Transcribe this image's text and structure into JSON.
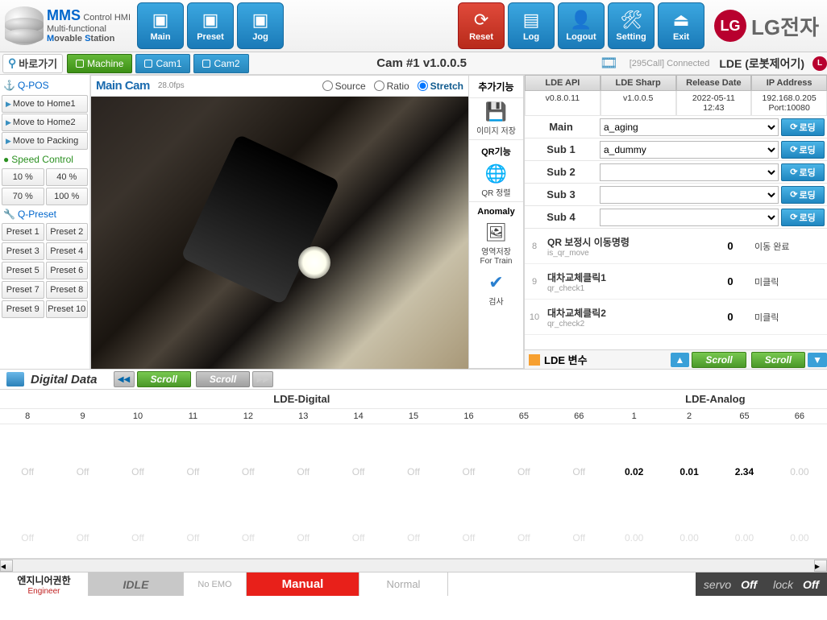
{
  "app": {
    "mms": "MMS",
    "ctrl": "Control HMI",
    "line1": "Multi-functional",
    "line2a": "M",
    "line2b": "ovable ",
    "line2c": "S",
    "line2d": "tation"
  },
  "hdr": {
    "main": "Main",
    "preset": "Preset",
    "jog": "Jog",
    "reset": "Reset",
    "log": "Log",
    "logout": "Logout",
    "setting": "Setting",
    "exit": "Exit"
  },
  "lg": {
    "circle": "LG",
    "text": "LG전자"
  },
  "sub": {
    "shortcuts": "바로가기",
    "machine": "Machine",
    "cam1": "Cam1",
    "cam2": "Cam2",
    "camtitle": "Cam #1 v1.0.0.5",
    "connected": "[295Call] Connected",
    "lde": "LDE (로봇제어기)"
  },
  "side": {
    "qpos": "Q-POS",
    "moves": [
      "Move to Home1",
      "Move to Home2",
      "Move to Packing"
    ],
    "speed": "Speed Control",
    "speeds": [
      "10 %",
      "40 %",
      "70 %",
      "100 %"
    ],
    "qpreset": "Q-Preset",
    "presets": [
      "Preset 1",
      "Preset 2",
      "Preset 3",
      "Preset 4",
      "Preset 5",
      "Preset 6",
      "Preset 7",
      "Preset 8",
      "Preset 9",
      "Preset 10"
    ]
  },
  "cam": {
    "name": "Main Cam",
    "fps": "28.0fps",
    "r1": "Source",
    "r2": "Ratio",
    "r3": "Stretch"
  },
  "extras": {
    "hdr": "추가기능",
    "save": "이미지 저장",
    "qrhdr": "QR기능",
    "qralign": "QR 정렬",
    "anomaly": "Anomaly",
    "train": "영역저장\nFor Train",
    "inspect": "검사"
  },
  "right": {
    "h": [
      "LDE API",
      "LDE Sharp",
      "Release Date",
      "IP Address"
    ],
    "v": [
      "v0.8.0.11",
      "v1.0.0.5",
      "2022-05-11\n12:43",
      "192.168.0.205\nPort:10080"
    ],
    "slots": [
      {
        "lbl": "Main",
        "val": "a_aging"
      },
      {
        "lbl": "Sub 1",
        "val": "a_dummy"
      },
      {
        "lbl": "Sub 2",
        "val": ""
      },
      {
        "lbl": "Sub 3",
        "val": ""
      },
      {
        "lbl": "Sub 4",
        "val": ""
      }
    ],
    "loading": "로딩",
    "vars": [
      {
        "i": "8",
        "n1": "QR 보정시 이동명령",
        "n2": "is_qr_move",
        "v": "0",
        "d": "이동 완료"
      },
      {
        "i": "9",
        "n1": "대차교체클릭1",
        "n2": "qr_check1",
        "v": "0",
        "d": "미클릭"
      },
      {
        "i": "10",
        "n1": "대차교체클릭2",
        "n2": "qr_check2",
        "v": "0",
        "d": "미클릭"
      }
    ],
    "ldevar": "LDE 변수",
    "scroll": "Scroll"
  },
  "dd": {
    "title": "Digital Data",
    "lbl1": "LDE-Digital",
    "lbl2": "LDE-Analog",
    "cols": [
      "8",
      "9",
      "10",
      "11",
      "12",
      "13",
      "14",
      "15",
      "16",
      "65",
      "66",
      "1",
      "2",
      "65",
      "66"
    ],
    "row1": [
      "Off",
      "Off",
      "Off",
      "Off",
      "Off",
      "Off",
      "Off",
      "Off",
      "Off",
      "Off",
      "Off",
      "0.02",
      "0.01",
      "2.34",
      "0.00"
    ],
    "row2": [
      "Off",
      "Off",
      "Off",
      "Off",
      "Off",
      "Off",
      "Off",
      "Off",
      "Off",
      "Off",
      "Off",
      "0.00",
      "0.00",
      "0.00",
      "0.00"
    ]
  },
  "foot": {
    "eng1": "엔지니어권한",
    "eng2": "Engineer",
    "idle": "IDLE",
    "noemo": "No EMO",
    "manual": "Manual",
    "normal": "Normal",
    "servo": "servo",
    "servoV": "Off",
    "lock": "lock",
    "lockV": "Off"
  }
}
